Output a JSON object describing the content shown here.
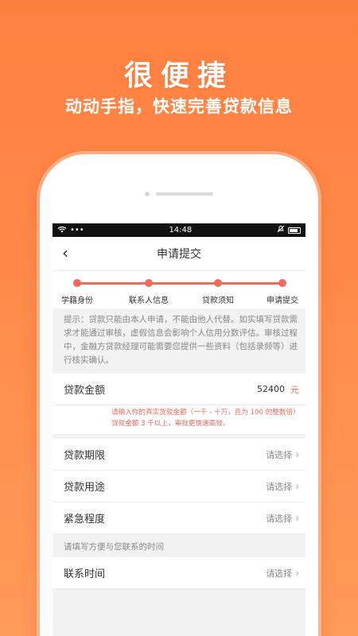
{
  "promo": {
    "headline": "很便捷",
    "subline": "动动手指，快速完善贷款信息"
  },
  "statusbar": {
    "time": "14:48",
    "wifi_icon": "wifi-icon",
    "more_icon": "more-dots-icon",
    "mute_icon": "silent-bell-icon",
    "battery_icon": "battery-icon"
  },
  "navbar": {
    "back_icon": "‹",
    "title": "申请提交"
  },
  "steps": [
    {
      "label": "学籍身份"
    },
    {
      "label": "联系人信息"
    },
    {
      "label": "贷款须知"
    },
    {
      "label": "申请提交"
    }
  ],
  "tip": "提示：贷款只能由本人申请，不能由他人代替。如实填写贷款需求才能通过审核，虚假信息会影响个人信用分数评估。审核过程中，金融方贷款经理可能需要您提供一些资料（包括录频等）进行核实确认。",
  "form": {
    "amount": {
      "label": "贷款金额",
      "value": "52400",
      "unit": "元"
    },
    "amount_hint": "请输入你的真实贷款金额（一千 - 十万，且为 100 的整数倍）贷款金额 3 千以上，审批更快速高效。",
    "term": {
      "label": "贷款期限",
      "placeholder": "请选择"
    },
    "purpose": {
      "label": "贷款用途",
      "placeholder": "请选择"
    },
    "urgency": {
      "label": "紧急程度",
      "placeholder": "请选择"
    },
    "contact_hint": "请填写方便与您联系的时间",
    "contact_time": {
      "label": "联系时间",
      "placeholder": "请选择"
    }
  },
  "colors": {
    "brand_orange": "#ff7f3f",
    "accent_red": "#f06a5b"
  }
}
